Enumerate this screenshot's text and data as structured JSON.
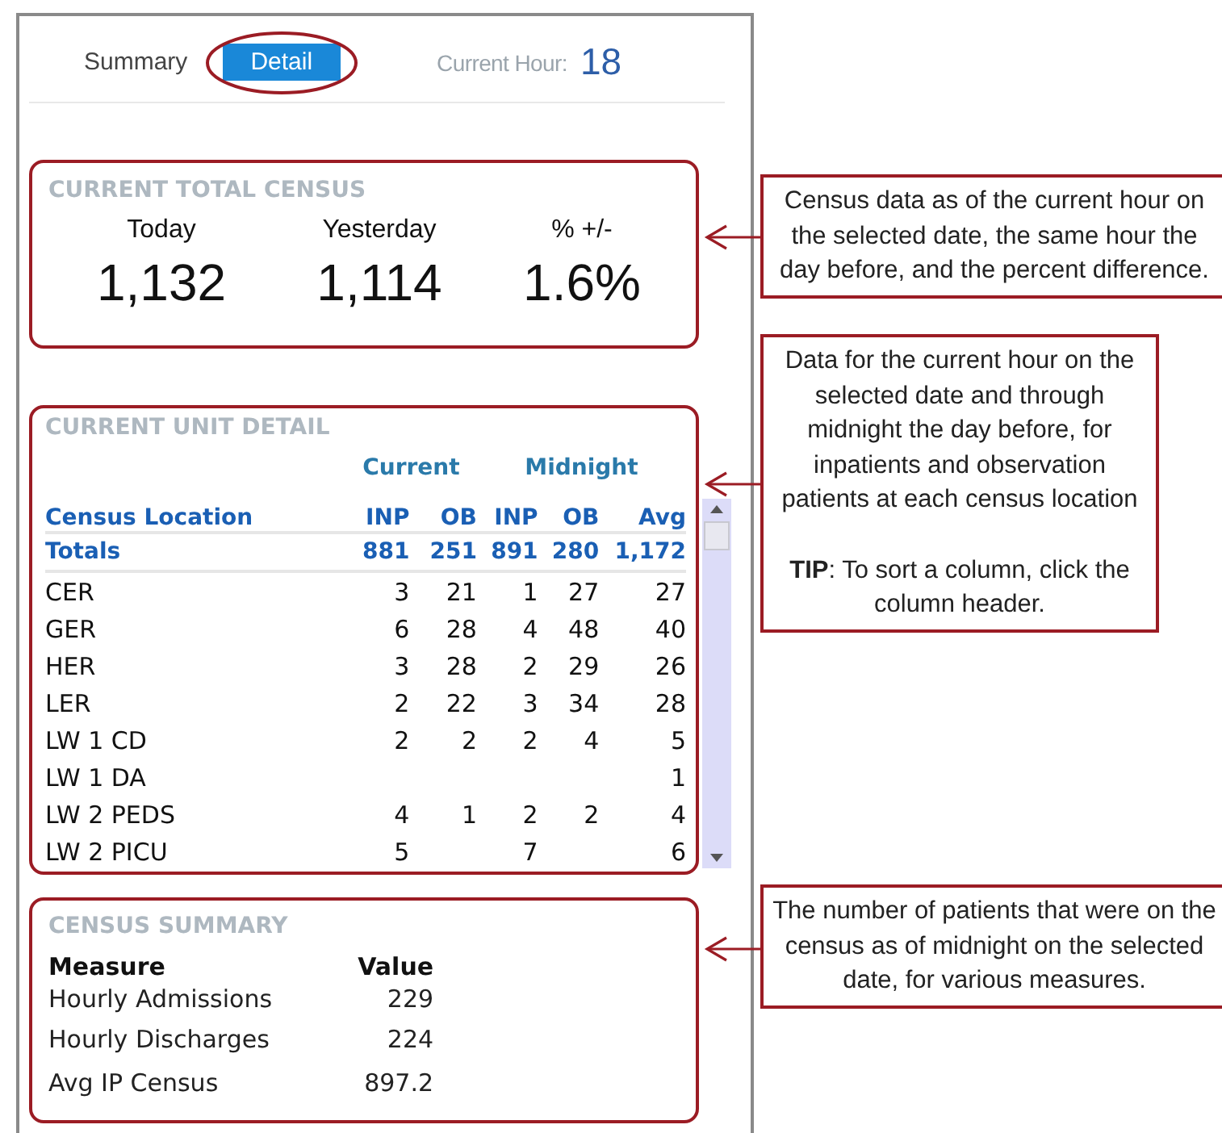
{
  "tabs": [
    {
      "label": "Summary",
      "selected": false,
      "highlighted": false
    },
    {
      "label": "Detail",
      "selected": true,
      "highlighted": true
    }
  ],
  "current_hour": {
    "label": "Current Hour:",
    "value": "18"
  },
  "total_census": {
    "title": "CURRENT TOTAL CENSUS",
    "metrics": [
      {
        "label": "Today",
        "value": "1,132"
      },
      {
        "label": "Yesterday",
        "value": "1,114"
      },
      {
        "label": "% +/-",
        "value": "1.6%"
      }
    ]
  },
  "unit_detail": {
    "title": "CURRENT UNIT DETAIL",
    "groups": [
      "Current",
      "Midnight"
    ],
    "columns": [
      "Census Location",
      "INP",
      "OB",
      "INP",
      "OB",
      "Avg"
    ],
    "totals": [
      "Totals",
      "881",
      "251",
      "891",
      "280",
      "1,172"
    ],
    "rows": [
      [
        "CER",
        "3",
        "21",
        "1",
        "27",
        "27"
      ],
      [
        "GER",
        "6",
        "28",
        "4",
        "48",
        "40"
      ],
      [
        "HER",
        "3",
        "28",
        "2",
        "29",
        "26"
      ],
      [
        "LER",
        "2",
        "22",
        "3",
        "34",
        "28"
      ],
      [
        "LW 1 CD",
        "2",
        "2",
        "2",
        "4",
        "5"
      ],
      [
        "LW 1 DA",
        null,
        null,
        null,
        null,
        "1"
      ],
      [
        "LW 2 PEDS",
        "4",
        "1",
        "2",
        "2",
        "4"
      ],
      [
        "LW 2 PICU",
        "5",
        null,
        "7",
        null,
        "6"
      ]
    ]
  },
  "census_summary": {
    "title": "CENSUS SUMMARY",
    "columns": [
      "Measure",
      "Value"
    ],
    "rows": [
      [
        "Hourly Admissions",
        "229"
      ],
      [
        "Hourly Discharges",
        "224"
      ],
      [
        "Avg IP Census",
        "897.2"
      ]
    ]
  },
  "annotations": [
    {
      "text": "Census data as of the current hour on the selected date, the same hour the day before, and the percent difference."
    },
    {
      "text": "Data for the current hour on the selected date and through midnight the day before, for inpatients and observation patients at each census location",
      "tip": "**TIP**: To sort a column, click the column header."
    },
    {
      "text": "The number of patients that were on the census as of midnight on the selected date, for various measures."
    }
  ]
}
